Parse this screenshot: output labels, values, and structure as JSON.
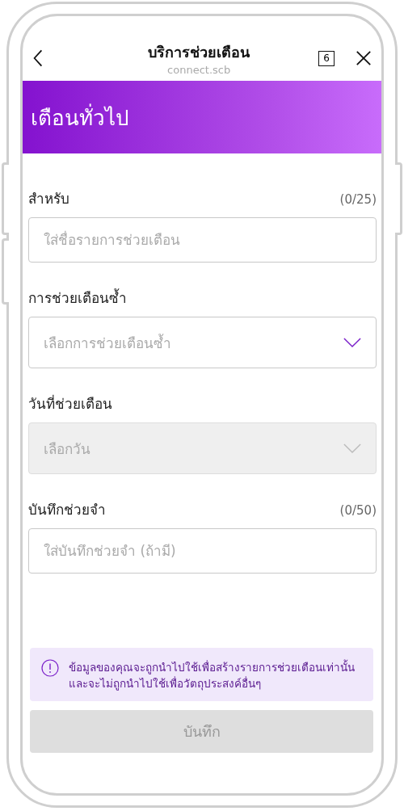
{
  "header": {
    "title": "บริการช่วยเตือน",
    "subtitle": "connect.scb",
    "tab_count": "6"
  },
  "banner": {
    "title": "เตือนทั่วไป"
  },
  "fields": [
    {
      "label": "สำหรับ",
      "counter": "(0/25)",
      "kind": "text",
      "placeholder": "ใส่ชื่อรายการช่วยเตือน",
      "disabled": false
    },
    {
      "label": "การช่วยเตือนซ้ำ",
      "kind": "select",
      "placeholder": "เลือกการช่วยเตือนซ้ำ",
      "disabled": false
    },
    {
      "label": "วันที่ช่วยเตือน",
      "kind": "select",
      "placeholder": "เลือกวัน",
      "disabled": true
    },
    {
      "label": "บันทึกช่วยจำ",
      "counter": "(0/50)",
      "kind": "text",
      "placeholder": "ใส่บันทึกช่วยจำ (ถ้ามี)",
      "disabled": false
    }
  ],
  "notice": {
    "text": "ข้อมูลของคุณจะถูกนำไปใช้เพื่อสร้างรายการช่วยเตือนเท่านั้น และจะไม่ถูกนำไปใช้เพื่อวัตถุประสงค์อื่นๆ"
  },
  "save_button": {
    "label": "บันทึก",
    "disabled": true
  }
}
